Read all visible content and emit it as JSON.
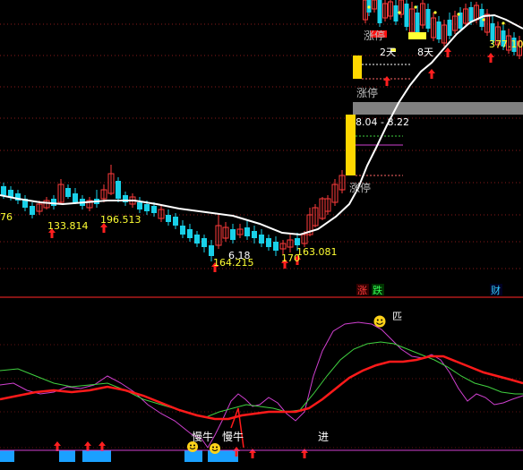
{
  "colors": {
    "background": "#000000",
    "grid": "#8a1a1a",
    "divider": "#b01a1a",
    "up_candle": "#ff3b3b",
    "down_candle": "#19d0e8",
    "ma_line": "#ffffff",
    "label_yellow": "#ffff33",
    "label_white": "#ffffff",
    "label_gray": "#bdbdbd",
    "arrow_red": "#ff1f1f",
    "limit_bar": "#ffd700",
    "band_gray": "#808080",
    "osc_magenta": "#d040d0",
    "osc_green": "#40d040",
    "osc_red": "#ff1a1a",
    "signal_blue": "#1aa0ff",
    "smiley": "#ffd21a"
  },
  "chart_data": [
    {
      "type": "candlestick",
      "panel": "price",
      "title": "",
      "price_labels": [
        {
          "text": "76"
        },
        {
          "text": "133.814"
        },
        {
          "text": "196.513"
        },
        {
          "text": "164.215"
        },
        {
          "text": "6.18"
        },
        {
          "text": "170"
        },
        {
          "text": "163.081"
        },
        {
          "text": "377.10"
        }
      ],
      "annotations": [
        {
          "text": "涨停",
          "color": "gray"
        },
        {
          "text": "涨停",
          "color": "gray"
        },
        {
          "text": "涨停",
          "color": "gray"
        },
        {
          "text": "8.04 - 8.22",
          "color": "white"
        },
        {
          "text": "2天",
          "color": "white"
        },
        {
          "text": "8天",
          "color": "white"
        }
      ],
      "legend_tags": [
        {
          "text": "涨",
          "color": "red"
        },
        {
          "text": "跌",
          "color": "green"
        },
        {
          "text": "财",
          "color": "cyan"
        }
      ],
      "ma_line": {
        "name": "",
        "shape": "dips then climbs steeply, peaks near the top right and eases down"
      },
      "limit_up_bars": 2
    },
    {
      "type": "line",
      "panel": "oscillator",
      "series": [
        {
          "color": "magenta"
        },
        {
          "color": "green"
        },
        {
          "color": "red"
        }
      ],
      "signal_labels": [
        "慢牛",
        "慢牛",
        "进"
      ],
      "peak_mark": "smiley",
      "partial_label": "匹"
    }
  ]
}
